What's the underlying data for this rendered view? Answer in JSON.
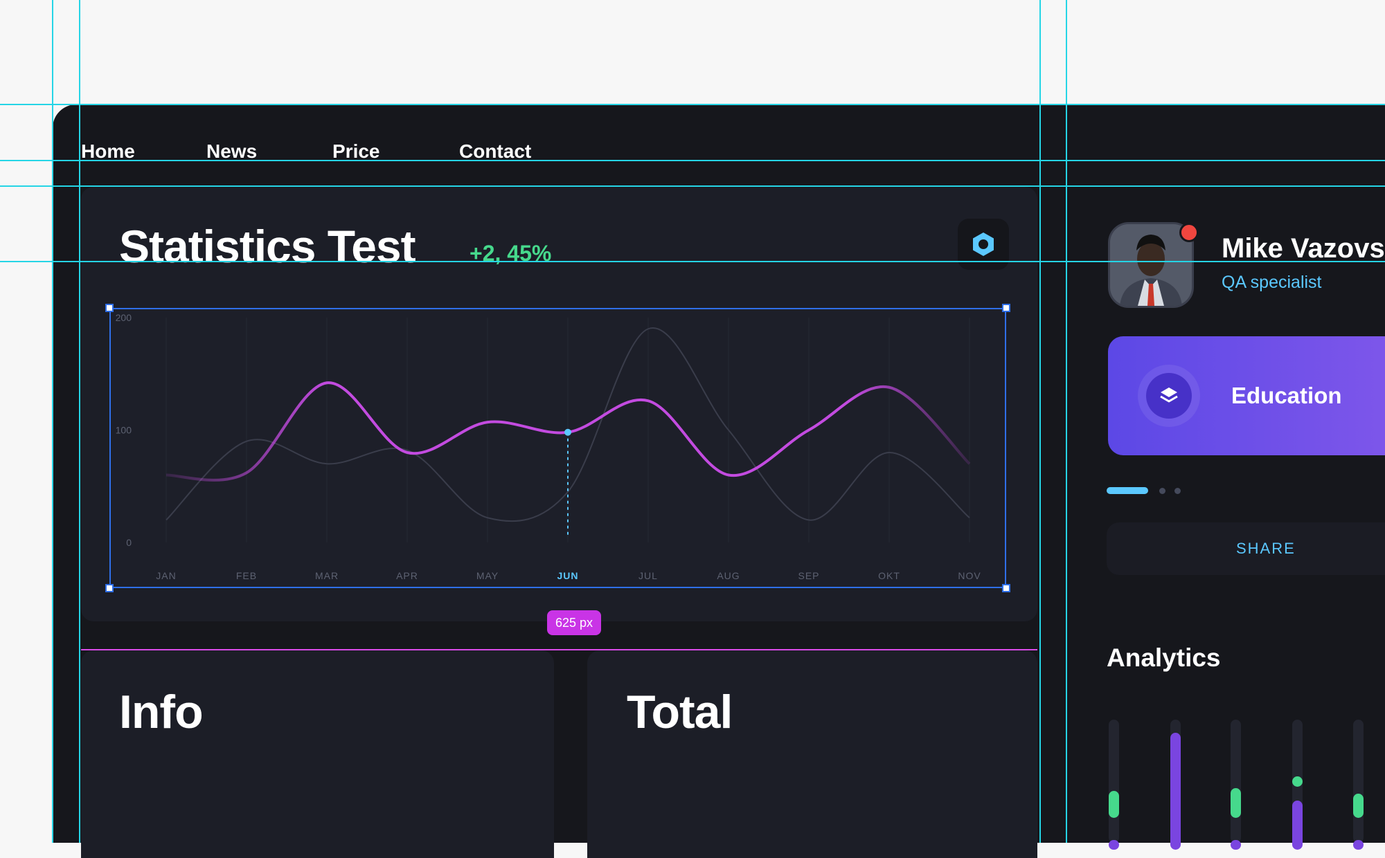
{
  "nav": {
    "items": [
      {
        "label": "Home"
      },
      {
        "label": "News"
      },
      {
        "label": "Price"
      },
      {
        "label": "Contact"
      }
    ]
  },
  "stats": {
    "title": "Statistics Test",
    "delta": "+2, 45%",
    "settings_icon": "hexagon-settings-icon",
    "accent": "#c34be0",
    "measurement_badge": "625 px"
  },
  "chart_data": {
    "type": "line",
    "categories": [
      "JAN",
      "FEB",
      "MAR",
      "APR",
      "MAY",
      "JUN",
      "JUL",
      "AUG",
      "SEP",
      "OKT",
      "NOV"
    ],
    "highlighted_category": "JUN",
    "y_ticks": [
      "200",
      "100",
      "0"
    ],
    "ylim": [
      0,
      200
    ],
    "grid": true,
    "series": [
      {
        "color": "#c34be0",
        "values": [
          60,
          62,
          142,
          80,
          107,
          98,
          126,
          60,
          100,
          138,
          70
        ]
      },
      {
        "color": "#3a3d4b",
        "values": [
          20,
          90,
          70,
          82,
          22,
          45,
          190,
          100,
          20,
          80,
          22
        ]
      }
    ]
  },
  "info": {
    "title": "Info"
  },
  "total": {
    "title": "Total"
  },
  "profile": {
    "name": "Mike Vazovs",
    "role": "QA specialist",
    "notification_color": "#f0463f"
  },
  "education": {
    "label": "Education",
    "icon": "layers-icon"
  },
  "share": {
    "label": "SHARE"
  },
  "analytics": {
    "title": "Analytics",
    "bars": [
      {
        "green": 0.55,
        "purple": 0.08
      },
      {
        "purple": 0.95
      },
      {
        "green": 0.62,
        "purple": 0.08
      },
      {
        "green": 0.15,
        "purple": 0.4
      },
      {
        "green": 0.5,
        "purple": 0.08
      }
    ]
  }
}
